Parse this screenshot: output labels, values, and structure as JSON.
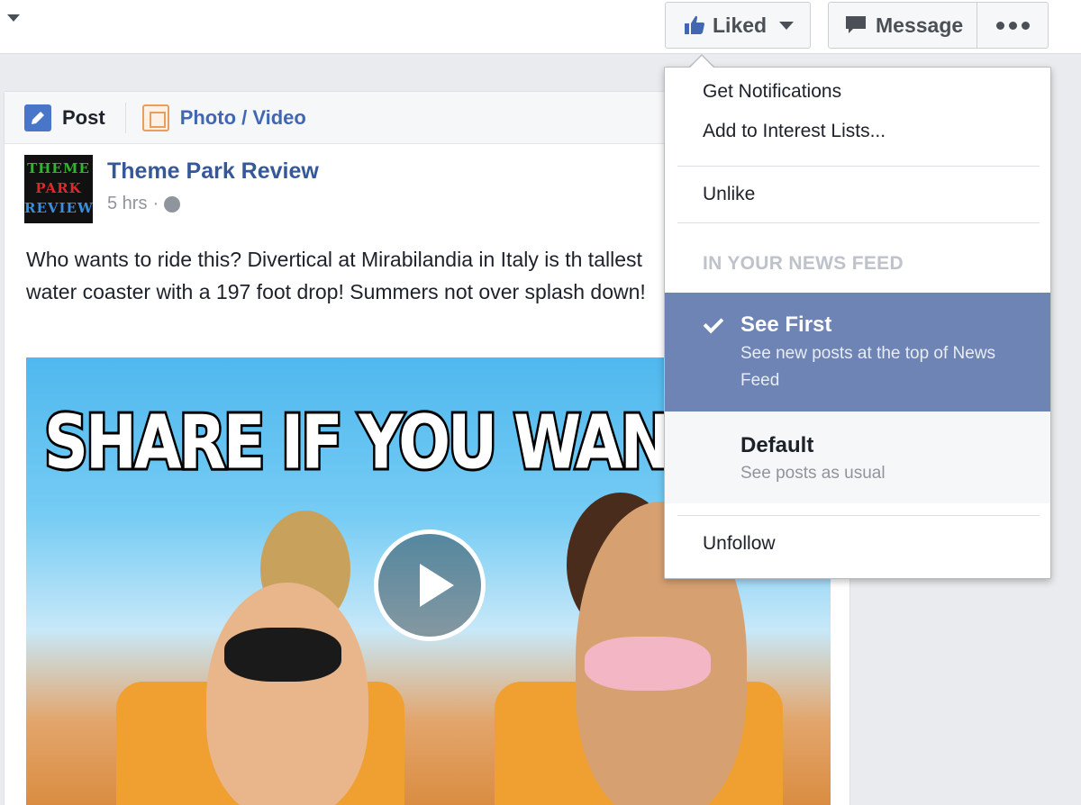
{
  "header": {
    "liked_label": "Liked",
    "message_label": "Message",
    "more_icon": "more-dots-icon"
  },
  "composer": {
    "post_label": "Post",
    "photo_video_label": "Photo / Video"
  },
  "post": {
    "author": "Theme Park Review",
    "avatar_lines": [
      "THEME",
      "PARK",
      "REVIEW"
    ],
    "time": "5 hrs",
    "separator": "·",
    "text": "Who wants to ride this? Divertical at Mirabilandia in Italy is th tallest water coaster with a 197 foot drop! Summers not over splash down!",
    "media_headline": "SHARE IF YOU WANT TO"
  },
  "menu": {
    "items_top": [
      "Get Notifications",
      "Add to Interest Lists..."
    ],
    "unlike": "Unlike",
    "section_header": "IN YOUR NEWS FEED",
    "options": [
      {
        "title": "See First",
        "desc": "See new posts at the top of News Feed",
        "selected": true
      },
      {
        "title": "Default",
        "desc": "See posts as usual",
        "selected": false
      }
    ],
    "unfollow": "Unfollow"
  },
  "colors": {
    "link_blue": "#365899",
    "selected_bg": "#6d84b4",
    "like_blue": "#4267b2"
  }
}
